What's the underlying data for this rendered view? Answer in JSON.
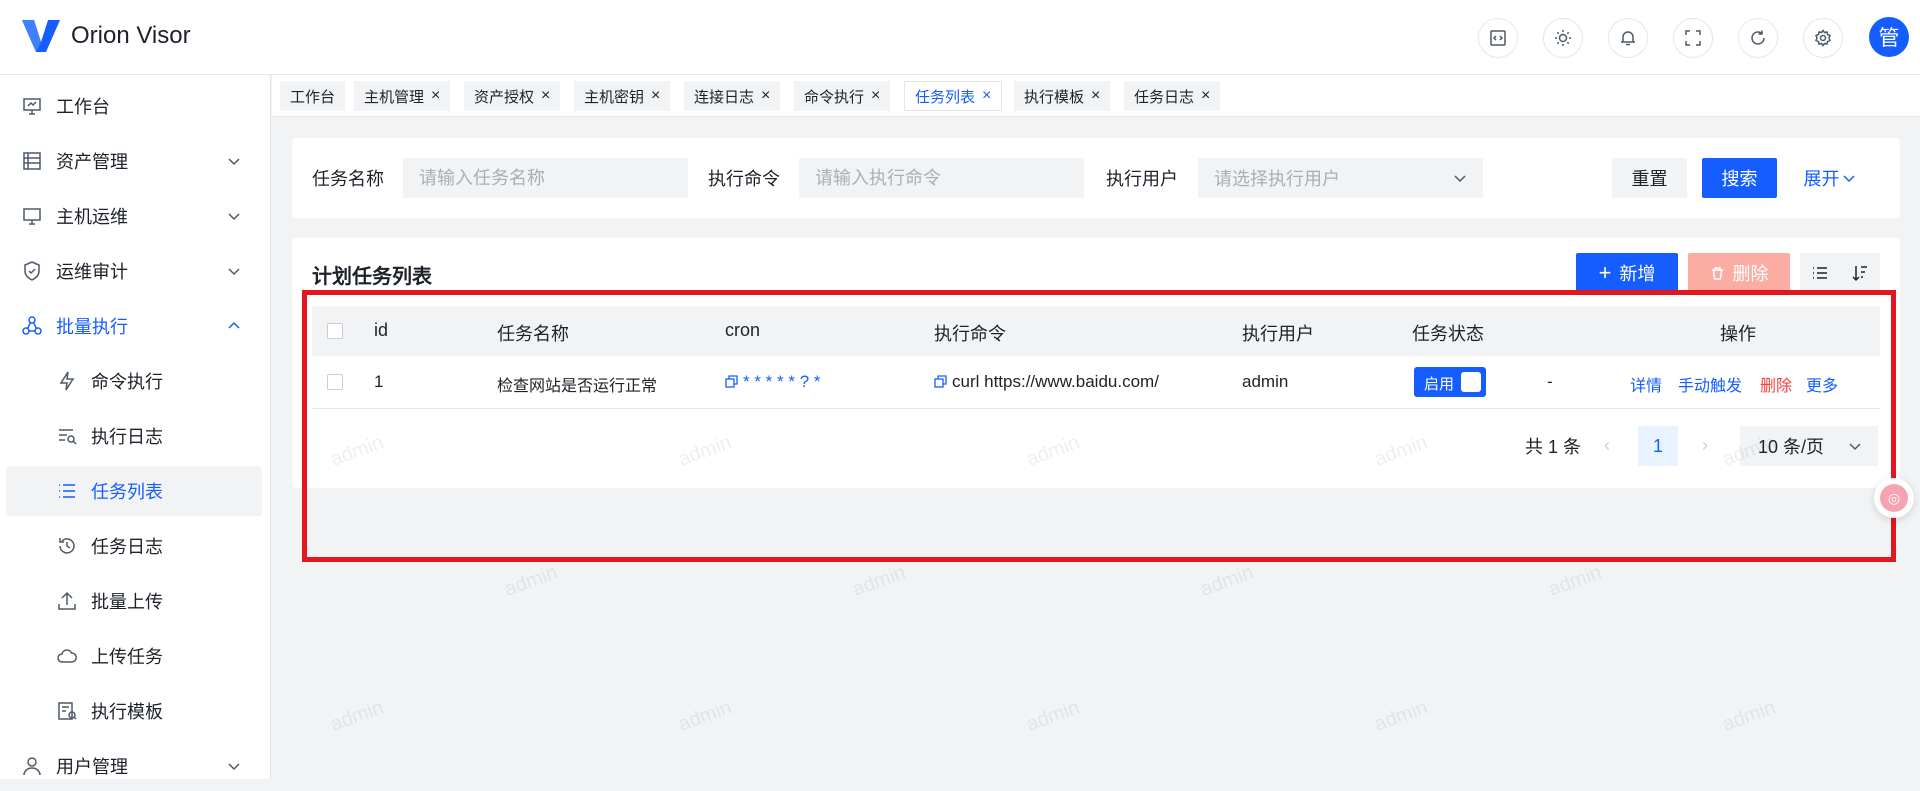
{
  "app": {
    "title": "Orion Visor",
    "avatar_text": "管",
    "watermark": "admin"
  },
  "header_icons": [
    "code-icon",
    "theme-icon",
    "bell-icon",
    "fullscreen-icon",
    "refresh-icon",
    "gear-icon"
  ],
  "sidebar": {
    "items": [
      {
        "label": "工作台",
        "icon": "monitor-icon"
      },
      {
        "label": "资产管理",
        "icon": "list-icon",
        "expandable": true
      },
      {
        "label": "主机运维",
        "icon": "desktop-icon",
        "expandable": true
      },
      {
        "label": "运维审计",
        "icon": "shield-icon",
        "expandable": true
      },
      {
        "label": "批量执行",
        "icon": "nodes-icon",
        "expandable": true,
        "open": true
      },
      {
        "label": "命令执行",
        "icon": "bolt-icon",
        "sub": true
      },
      {
        "label": "执行日志",
        "icon": "log-search-icon",
        "sub": true
      },
      {
        "label": "任务列表",
        "icon": "task-list-icon",
        "sub": true,
        "active": true
      },
      {
        "label": "任务日志",
        "icon": "history-icon",
        "sub": true
      },
      {
        "label": "批量上传",
        "icon": "upload-icon",
        "sub": true
      },
      {
        "label": "上传任务",
        "icon": "cloud-icon",
        "sub": true
      },
      {
        "label": "执行模板",
        "icon": "template-icon",
        "sub": true
      },
      {
        "label": "用户管理",
        "icon": "user-icon",
        "expandable": true
      }
    ]
  },
  "tabs": [
    {
      "label": "工作台",
      "closable": false
    },
    {
      "label": "主机管理",
      "closable": true
    },
    {
      "label": "资产授权",
      "closable": true
    },
    {
      "label": "主机密钥",
      "closable": true
    },
    {
      "label": "连接日志",
      "closable": true
    },
    {
      "label": "命令执行",
      "closable": true
    },
    {
      "label": "任务列表",
      "closable": true,
      "active": true
    },
    {
      "label": "执行模板",
      "closable": true
    },
    {
      "label": "任务日志",
      "closable": true
    }
  ],
  "search": {
    "task_name_label": "任务名称",
    "task_name_placeholder": "请输入任务名称",
    "command_label": "执行命令",
    "command_placeholder": "请输入执行命令",
    "user_label": "执行用户",
    "user_placeholder": "请选择执行用户",
    "reset_label": "重置",
    "search_label": "搜索",
    "expand_label": "展开"
  },
  "table_card": {
    "title": "计划任务列表",
    "add_label": "新增",
    "delete_label": "删除",
    "columns": [
      "id",
      "任务名称",
      "cron",
      "执行命令",
      "执行用户",
      "任务状态",
      "操作"
    ],
    "rows": [
      {
        "id": "1",
        "name": "检查网站是否运行正常",
        "cron": "* * * * * ? *",
        "command": "curl https://www.baidu.com/",
        "user": "admin",
        "status_label": "启用",
        "status_enabled": true,
        "extra": "-",
        "ops": [
          "详情",
          "手动触发",
          "删除",
          "更多"
        ]
      }
    ]
  },
  "pagination": {
    "total": "共 1 条",
    "prev": "‹",
    "next": "›",
    "current": "1",
    "page_size": "10 条/页"
  },
  "colors": {
    "primary": "#165dff",
    "danger": "#f53f3f",
    "highlight": "#e3171f"
  }
}
